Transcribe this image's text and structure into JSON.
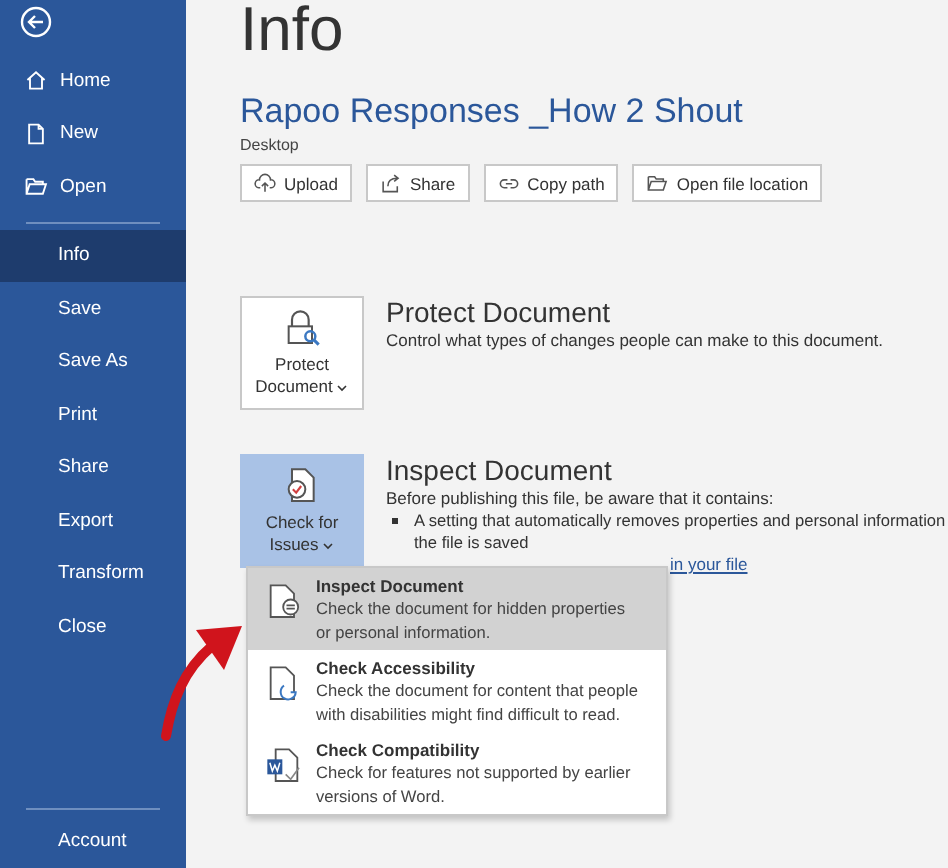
{
  "sidebar": {
    "top_items": [
      {
        "label": "Home",
        "kind": "home",
        "selected": false
      },
      {
        "label": "New",
        "kind": "new",
        "selected": false
      },
      {
        "label": "Open",
        "kind": "open",
        "selected": false
      }
    ],
    "items": [
      {
        "label": "Info",
        "selected": true
      },
      {
        "label": "Save",
        "selected": false
      },
      {
        "label": "Save As",
        "selected": false
      },
      {
        "label": "Print",
        "selected": false
      },
      {
        "label": "Share",
        "selected": false
      },
      {
        "label": "Export",
        "selected": false
      },
      {
        "label": "Transform",
        "selected": false
      },
      {
        "label": "Close",
        "selected": false
      }
    ],
    "footer_items": [
      {
        "label": "Account",
        "selected": false
      }
    ]
  },
  "page_title": "Info",
  "document": {
    "name": "Rapoo Responses _How 2 Shout",
    "location": "Desktop",
    "actions": [
      {
        "label": "Upload",
        "kind": "upload"
      },
      {
        "label": "Share",
        "kind": "share"
      },
      {
        "label": "Copy path",
        "kind": "link"
      },
      {
        "label": "Open file location",
        "kind": "folder"
      }
    ]
  },
  "sections": [
    {
      "kind": "protect",
      "button": [
        "Protect",
        "Document"
      ],
      "active": false,
      "title": "Protect Document",
      "description": "Control what types of changes people can make to this document."
    },
    {
      "kind": "inspect",
      "button": [
        "Check for",
        "Issues"
      ],
      "active": true,
      "title": "Inspect Document",
      "description": "Before publishing this file, be aware that it contains:",
      "bullets": [
        [
          "A setting that automatically removes properties and personal information",
          "the file is saved"
        ]
      ],
      "link": "in your file"
    }
  ],
  "menu": [
    {
      "kind": "inspect",
      "title": "Inspect Document",
      "description": [
        "Check the document for hidden properties",
        "or personal information."
      ],
      "selected": true
    },
    {
      "kind": "accessibility",
      "title": "Check Accessibility",
      "description": [
        "Check the document for content that people",
        "with disabilities might find difficult to read."
      ],
      "selected": false
    },
    {
      "kind": "compatibility",
      "title": "Check Compatibility",
      "description": [
        "Check for features not supported by earlier",
        "versions of Word."
      ],
      "selected": false
    }
  ]
}
